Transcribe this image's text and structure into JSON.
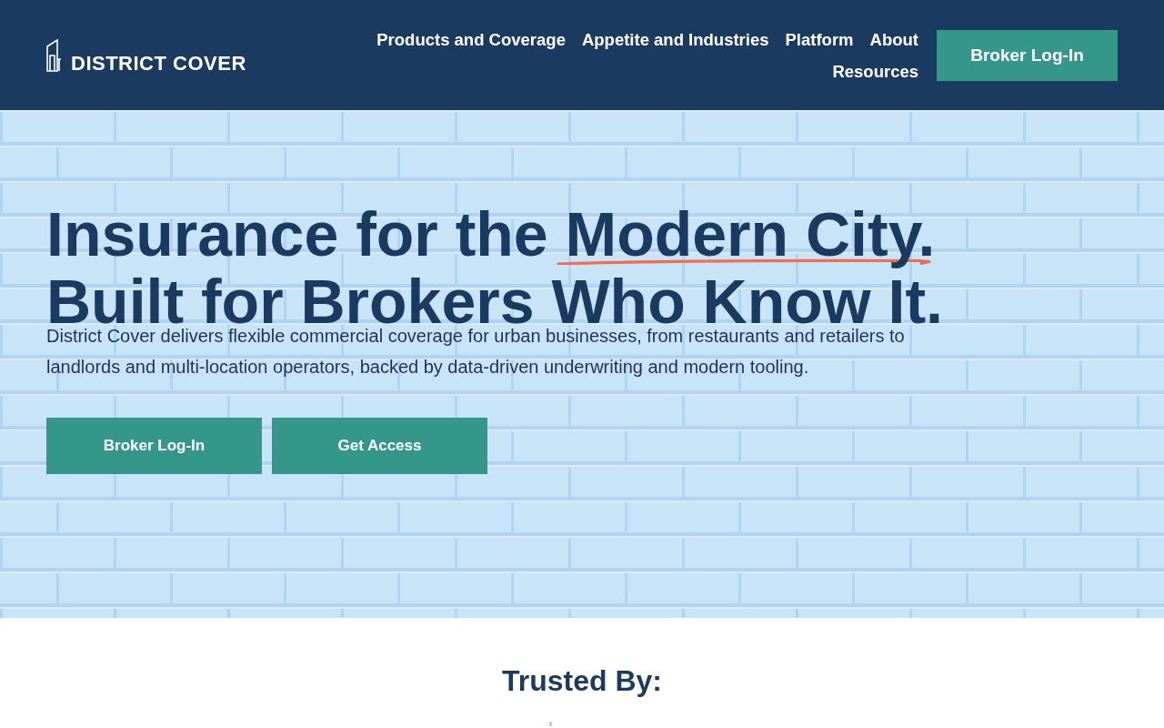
{
  "header": {
    "logo": {
      "text": "DISTRICT COVER"
    },
    "nav_links": [
      "Products and Coverage",
      "Appetite and Industries",
      "Platform",
      "About",
      "Resources"
    ],
    "login_button": "Broker Log-In"
  },
  "hero": {
    "headline": {
      "line_1": "Insurance for the",
      "highlight": "Modern City.",
      "line_2": "Built for Brokers Who Know It."
    },
    "description": "District Cover delivers flexible commercial coverage for urban businesses, from restaurants and retailers to landlords and multi-location operators, backed by data-driven underwriting and modern tooling.",
    "buttons": [
      "Broker Log-In",
      "Get Access"
    ]
  },
  "trusted": {
    "title": "Trusted By:"
  }
}
